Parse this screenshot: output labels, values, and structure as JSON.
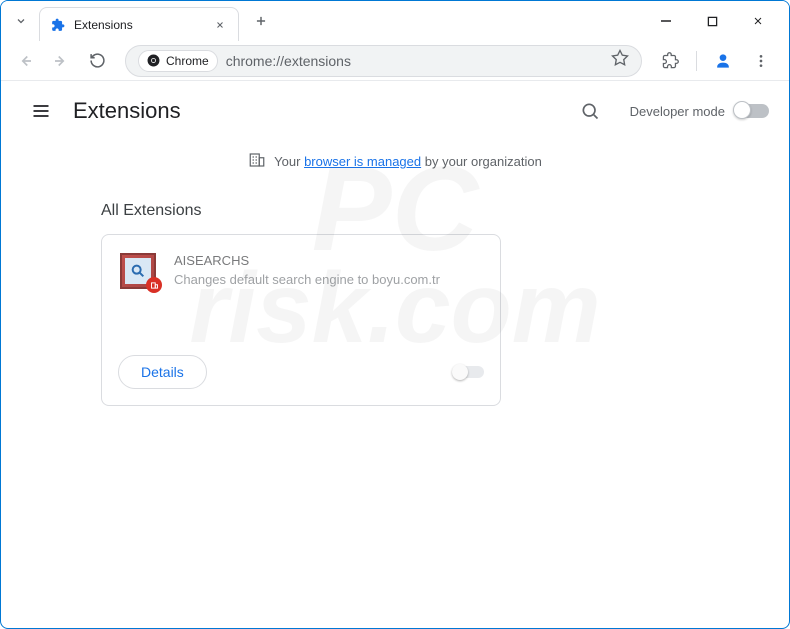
{
  "window": {
    "tab_title": "Extensions"
  },
  "toolbar": {
    "chrome_chip": "Chrome",
    "url": "chrome://extensions"
  },
  "page": {
    "title": "Extensions",
    "dev_mode_label": "Developer mode",
    "managed_prefix": "Your",
    "managed_link": "browser is managed",
    "managed_suffix": "by your organization",
    "all_extensions_label": "All Extensions"
  },
  "extension": {
    "name": "AISEARCHS",
    "description": "Changes default search engine to boyu.com.tr",
    "details_label": "Details",
    "enabled": false
  },
  "watermark": {
    "line1": "PC",
    "line2": "risk.com"
  }
}
